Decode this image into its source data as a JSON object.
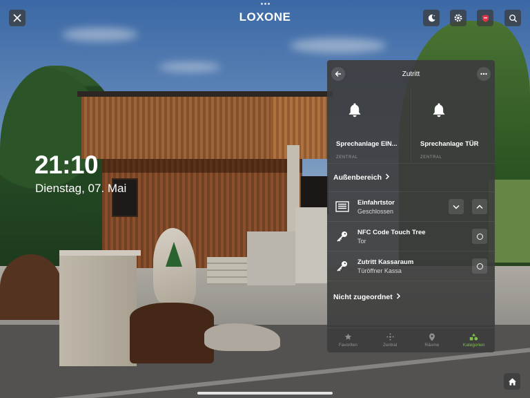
{
  "topbar": {
    "brand": "LOXONE",
    "icons": [
      "close-icon",
      "moon-icon",
      "gear-icon",
      "shield-icon",
      "search-icon"
    ]
  },
  "clock": {
    "time": "21:10",
    "date": "Dienstag, 07. Mai"
  },
  "panel": {
    "title": "Zutritt",
    "tiles": [
      {
        "name": "Sprechanlage EIN...",
        "tag": "ZENTRAL",
        "icon": "bell-icon"
      },
      {
        "name": "Sprechanlage TÜR",
        "tag": "ZENTRAL",
        "icon": "bell-icon"
      }
    ],
    "section_outdoor": "Außenbereich",
    "rows": [
      {
        "name": "Einfahrtstor",
        "status": "Geschlossen",
        "icon": "gate-icon"
      },
      {
        "name": "NFC Code Touch Tree",
        "status": "Tor",
        "icon": "key-icon"
      },
      {
        "name": "Zutritt Kassaraum",
        "status": "Türöffner Kassa",
        "icon": "key-icon"
      }
    ],
    "section_unassigned": "Nicht zugeordnet",
    "tabs": [
      {
        "label": "Favoriten",
        "icon": "star-icon",
        "active": false
      },
      {
        "label": "Zentral",
        "icon": "central-icon",
        "active": false
      },
      {
        "label": "Räume",
        "icon": "location-icon",
        "active": false
      },
      {
        "label": "Kategorien",
        "icon": "categories-icon",
        "active": true
      }
    ],
    "accent_color": "#7fc24a"
  }
}
